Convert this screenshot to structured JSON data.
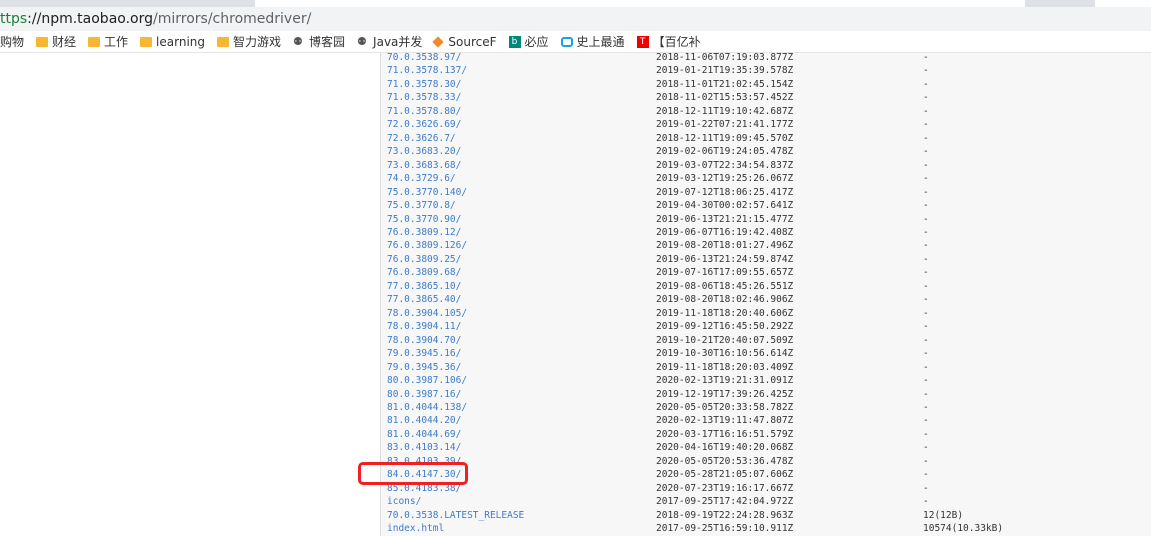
{
  "browser": {
    "url_scheme": "ttps",
    "url_host": "://npm.taobao.org",
    "url_path": "/mirrors/chromedriver/"
  },
  "bookmarks": [
    {
      "label": "购物",
      "icon": "none"
    },
    {
      "label": "财经",
      "icon": "folder-icon"
    },
    {
      "label": "工作",
      "icon": "folder-icon"
    },
    {
      "label": "learning",
      "icon": "folder-icon"
    },
    {
      "label": "智力游戏",
      "icon": "folder-icon"
    },
    {
      "label": "博客园",
      "icon": "github-icon"
    },
    {
      "label": "Java并发",
      "icon": "github-icon"
    },
    {
      "label": "SourceF",
      "icon": "sourceforge-icon"
    },
    {
      "label": "必应",
      "icon": "bing-icon"
    },
    {
      "label": "史上最通",
      "icon": "bilibili-icon"
    },
    {
      "label": "【百亿补",
      "icon": "t-icon"
    }
  ],
  "listing": [
    {
      "name": "70.0.3538.97/",
      "date": "2018-11-06T07:19:03.877Z",
      "size": "-"
    },
    {
      "name": "71.0.3578.137/",
      "date": "2019-01-21T19:35:39.578Z",
      "size": "-"
    },
    {
      "name": "71.0.3578.30/",
      "date": "2018-11-01T21:02:45.154Z",
      "size": "-"
    },
    {
      "name": "71.0.3578.33/",
      "date": "2018-11-02T15:53:57.452Z",
      "size": "-"
    },
    {
      "name": "71.0.3578.80/",
      "date": "2018-12-11T19:10:42.687Z",
      "size": "-"
    },
    {
      "name": "72.0.3626.69/",
      "date": "2019-01-22T07:21:41.177Z",
      "size": "-"
    },
    {
      "name": "72.0.3626.7/",
      "date": "2018-12-11T19:09:45.570Z",
      "size": "-"
    },
    {
      "name": "73.0.3683.20/",
      "date": "2019-02-06T19:24:05.478Z",
      "size": "-"
    },
    {
      "name": "73.0.3683.68/",
      "date": "2019-03-07T22:34:54.837Z",
      "size": "-"
    },
    {
      "name": "74.0.3729.6/",
      "date": "2019-03-12T19:25:26.067Z",
      "size": "-"
    },
    {
      "name": "75.0.3770.140/",
      "date": "2019-07-12T18:06:25.417Z",
      "size": "-"
    },
    {
      "name": "75.0.3770.8/",
      "date": "2019-04-30T00:02:57.641Z",
      "size": "-"
    },
    {
      "name": "75.0.3770.90/",
      "date": "2019-06-13T21:21:15.477Z",
      "size": "-"
    },
    {
      "name": "76.0.3809.12/",
      "date": "2019-06-07T16:19:42.408Z",
      "size": "-"
    },
    {
      "name": "76.0.3809.126/",
      "date": "2019-08-20T18:01:27.496Z",
      "size": "-"
    },
    {
      "name": "76.0.3809.25/",
      "date": "2019-06-13T21:24:59.874Z",
      "size": "-"
    },
    {
      "name": "76.0.3809.68/",
      "date": "2019-07-16T17:09:55.657Z",
      "size": "-"
    },
    {
      "name": "77.0.3865.10/",
      "date": "2019-08-06T18:45:26.551Z",
      "size": "-"
    },
    {
      "name": "77.0.3865.40/",
      "date": "2019-08-20T18:02:46.906Z",
      "size": "-"
    },
    {
      "name": "78.0.3904.105/",
      "date": "2019-11-18T18:20:40.606Z",
      "size": "-"
    },
    {
      "name": "78.0.3904.11/",
      "date": "2019-09-12T16:45:50.292Z",
      "size": "-"
    },
    {
      "name": "78.0.3904.70/",
      "date": "2019-10-21T20:40:07.509Z",
      "size": "-"
    },
    {
      "name": "79.0.3945.16/",
      "date": "2019-10-30T16:10:56.614Z",
      "size": "-"
    },
    {
      "name": "79.0.3945.36/",
      "date": "2019-11-18T18:20:03.409Z",
      "size": "-"
    },
    {
      "name": "80.0.3987.106/",
      "date": "2020-02-13T19:21:31.091Z",
      "size": "-"
    },
    {
      "name": "80.0.3987.16/",
      "date": "2019-12-19T17:39:26.425Z",
      "size": "-"
    },
    {
      "name": "81.0.4044.138/",
      "date": "2020-05-05T20:33:58.782Z",
      "size": "-"
    },
    {
      "name": "81.0.4044.20/",
      "date": "2020-02-13T19:11:47.807Z",
      "size": "-"
    },
    {
      "name": "81.0.4044.69/",
      "date": "2020-03-17T16:16:51.579Z",
      "size": "-"
    },
    {
      "name": "83.0.4103.14/",
      "date": "2020-04-16T19:40:20.068Z",
      "size": "-"
    },
    {
      "name": "83.0.4103.39/",
      "date": "2020-05-05T20:53:36.478Z",
      "size": "-"
    },
    {
      "name": "84.0.4147.30/",
      "date": "2020-05-28T21:05:07.606Z",
      "size": "-"
    },
    {
      "name": "85.0.4183.38/",
      "date": "2020-07-23T19:16:17.667Z",
      "size": "-"
    },
    {
      "name": "icons/",
      "date": "2017-09-25T17:42:04.972Z",
      "size": "-"
    },
    {
      "name": "70.0.3538.LATEST_RELEASE",
      "date": "2018-09-19T22:24:28.963Z",
      "size": "12(12B)"
    },
    {
      "name": "index.html",
      "date": "2017-09-25T16:59:10.911Z",
      "size": "10574(10.33kB)"
    }
  ],
  "colors": {
    "highlight": "#f02020",
    "link": "#3d7cc9"
  }
}
